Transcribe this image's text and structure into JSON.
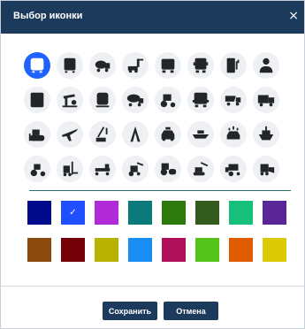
{
  "dialog": {
    "title": "Выбор иконки",
    "close_glyph": "×"
  },
  "icons": [
    {
      "name": "bus-front-icon",
      "selected": true
    },
    {
      "name": "bus-icon",
      "selected": false
    },
    {
      "name": "concrete-mixer-icon",
      "selected": false
    },
    {
      "name": "loader-crane-icon",
      "selected": false
    },
    {
      "name": "truck-front-icon",
      "selected": false
    },
    {
      "name": "semi-truck-front-icon",
      "selected": false
    },
    {
      "name": "fuel-station-icon",
      "selected": false
    },
    {
      "name": "person-icon",
      "selected": false
    },
    {
      "name": "oil-drop-station-icon",
      "selected": false
    },
    {
      "name": "oil-pump-jack-icon",
      "selected": false
    },
    {
      "name": "train-icon",
      "selected": false
    },
    {
      "name": "tanker-truck-icon",
      "selected": false
    },
    {
      "name": "tractor-icon",
      "selected": false
    },
    {
      "name": "tank-truck-front-icon",
      "selected": false
    },
    {
      "name": "dump-truck-icon",
      "selected": false
    },
    {
      "name": "cargo-truck-icon",
      "selected": false
    },
    {
      "name": "bulldozer-icon",
      "selected": false
    },
    {
      "name": "airplane-icon",
      "selected": false
    },
    {
      "name": "crane-icon",
      "selected": false
    },
    {
      "name": "drilling-rig-icon",
      "selected": false
    },
    {
      "name": "taxi-icon",
      "selected": false
    },
    {
      "name": "boat-icon",
      "selected": false
    },
    {
      "name": "snow-car-icon",
      "selected": false
    },
    {
      "name": "ship-icon",
      "selected": false
    },
    {
      "name": "farm-tractor-icon",
      "selected": false
    },
    {
      "name": "forklift-icon",
      "selected": false
    },
    {
      "name": "grader-icon",
      "selected": false
    },
    {
      "name": "backhoe-loader-icon",
      "selected": false
    },
    {
      "name": "road-roller-icon",
      "selected": false
    },
    {
      "name": "excavator-icon",
      "selected": false
    },
    {
      "name": "combine-harvester-icon",
      "selected": false
    },
    {
      "name": "skid-steer-loader-icon",
      "selected": false
    }
  ],
  "colors": [
    {
      "hex": "#000b8c",
      "selected": false
    },
    {
      "hex": "#1f4fff",
      "selected": true
    },
    {
      "hex": "#b02ad8",
      "selected": false
    },
    {
      "hex": "#0a7a7a",
      "selected": false
    },
    {
      "hex": "#2b7a0b",
      "selected": false
    },
    {
      "hex": "#345b1e",
      "selected": false
    },
    {
      "hex": "#16c07a",
      "selected": false
    },
    {
      "hex": "#5a2596",
      "selected": false
    },
    {
      "hex": "#8b4a0c",
      "selected": false
    },
    {
      "hex": "#760008",
      "selected": false
    },
    {
      "hex": "#b8b100",
      "selected": false
    },
    {
      "hex": "#1a8df5",
      "selected": false
    },
    {
      "hex": "#b0105a",
      "selected": false
    },
    {
      "hex": "#55c41a",
      "selected": false
    },
    {
      "hex": "#e05a00",
      "selected": false
    },
    {
      "hex": "#dcca05",
      "selected": false
    }
  ],
  "check_glyph": "✓",
  "buttons": {
    "save": "Сохранить",
    "cancel": "Отмена"
  },
  "accent": "#1b3a5c"
}
